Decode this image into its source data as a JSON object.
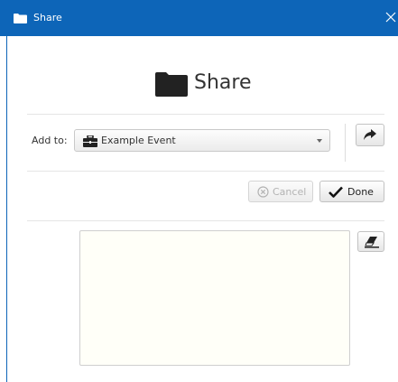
{
  "window": {
    "title": "Share",
    "icon": "folder-icon",
    "close_icon": "close-icon",
    "accent_color": "#0d65b8"
  },
  "header": {
    "icon": "folder-icon",
    "title": "Share"
  },
  "form": {
    "add_to_label": "Add to:",
    "add_to_select": {
      "icon": "briefcase-icon",
      "selected_value": "Example Event"
    },
    "share_button_icon": "share-arrow-icon"
  },
  "actions": {
    "cancel_label": "Cancel",
    "cancel_icon": "cancel-circle-icon",
    "cancel_enabled": false,
    "done_label": "Done",
    "done_icon": "checkmark-icon"
  },
  "text_area": {
    "value": "",
    "eraser_icon": "eraser-icon"
  }
}
